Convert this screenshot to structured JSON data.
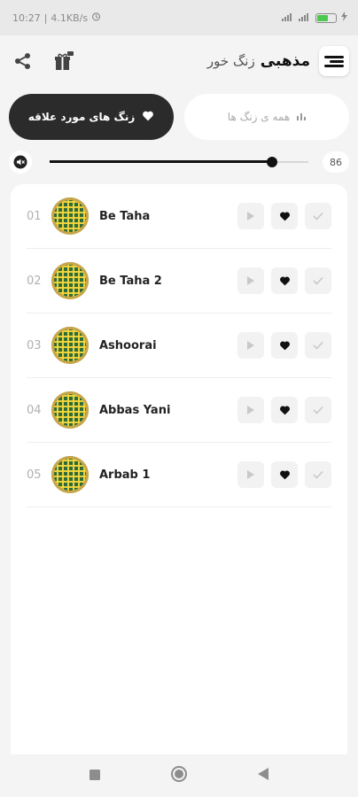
{
  "status_bar": {
    "time": "10:27",
    "speed": "4.1KB/s",
    "battery_level": 0.6
  },
  "header": {
    "title_bold": "مذهبی",
    "title_light": "زنگ خور"
  },
  "tabs": {
    "favorites": "زنگ های مورد علاقه",
    "all": "همه ی زنگ ها"
  },
  "volume": {
    "value": "86",
    "level": 0.86
  },
  "tracks": [
    {
      "num": "01",
      "name": "Be Taha"
    },
    {
      "num": "02",
      "name": "Be Taha 2"
    },
    {
      "num": "03",
      "name": "Ashoorai"
    },
    {
      "num": "04",
      "name": "Abbas Yani"
    },
    {
      "num": "05",
      "name": "Arbab 1"
    }
  ],
  "colors": {
    "accent": "#111111",
    "tab_active": "#2b2b2b",
    "battery": "#4cc94c"
  }
}
